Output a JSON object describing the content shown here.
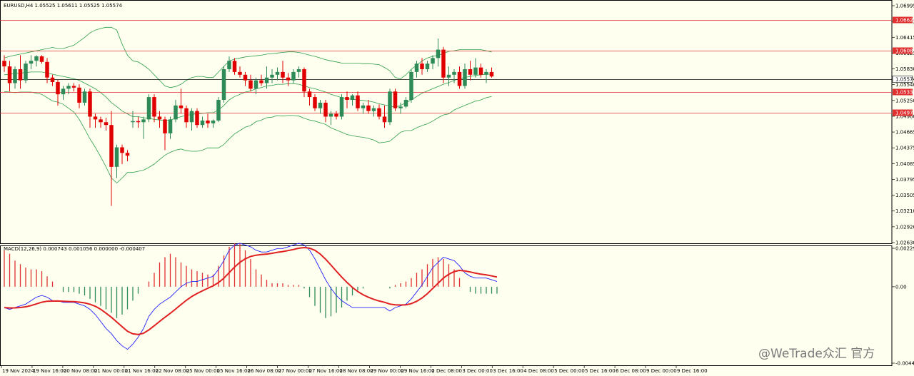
{
  "header": {
    "symbol": "EURUSD,H4",
    "ohlc": "1.05525 1.05611 1.05525 1.05574",
    "macd_label": "MACD(12,26,9) 0.000743 0.001056 0.000000 -0.000407"
  },
  "watermark": "@WeTrade众汇 官方",
  "colors": {
    "bull": "#2e8b57",
    "bear": "#e00000",
    "band": "#2e9e4a",
    "macd": "#2020ff",
    "signal": "#e02020",
    "level": "#e03030"
  },
  "chart_data": [
    {
      "type": "candlestick",
      "ylim": [
        1.0263,
        1.0699
      ],
      "price_ticks": [
        "1.06995",
        "1.06705",
        "1.06415",
        "1.06125",
        "1.05830",
        "1.05540",
        "1.05250",
        "1.04960",
        "1.04665",
        "1.04375",
        "1.04085",
        "1.03795",
        "1.03505",
        "1.03210",
        "1.02920",
        "1.02630"
      ],
      "level_labels": [
        "1.06628",
        "1.06085",
        "1.05574",
        "1.05338",
        "1.04971"
      ],
      "levels": [
        1.06628,
        1.06085,
        1.05338,
        1.04971
      ],
      "current_price": 1.05574,
      "x_labels": [
        "19 Nov 2024",
        "19 Nov 16:00",
        "20 Nov 08:00",
        "21 Nov 00:00",
        "21 Nov 16:00",
        "22 Nov 08:00",
        "25 Nov 00:00",
        "25 Nov 16:00",
        "26 Nov 08:00",
        "27 Nov 00:00",
        "27 Nov 16:00",
        "28 Nov 08:00",
        "29 Nov 00:00",
        "29 Nov 16:00",
        "2 Dec 08:00",
        "3 Dec 00:00",
        "3 Dec 16:00",
        "4 Dec 08:00",
        "5 Dec 00:00",
        "5 Dec 16:00",
        "6 Dec 08:00",
        "9 Dec 00:00",
        "9 Dec 16:00"
      ],
      "candles": [
        [
          1.059,
          1.06,
          1.057,
          1.058
        ],
        [
          1.058,
          1.059,
          1.0535,
          1.055
        ],
        [
          1.055,
          1.058,
          1.054,
          1.0575
        ],
        [
          1.0575,
          1.06,
          1.054,
          1.0555
        ],
        [
          1.0555,
          1.059,
          1.055,
          1.0585
        ],
        [
          1.0585,
          1.06,
          1.0575,
          1.059
        ],
        [
          1.059,
          1.06,
          1.058,
          1.0598
        ],
        [
          1.0598,
          1.06,
          1.0585,
          1.0588
        ],
        [
          1.0588,
          1.0595,
          1.055,
          1.056
        ],
        [
          1.056,
          1.0565,
          1.0545,
          1.0552
        ],
        [
          1.0552,
          1.0556,
          1.051,
          1.053
        ],
        [
          1.053,
          1.0545,
          1.052,
          1.054
        ],
        [
          1.054,
          1.055,
          1.053,
          1.0545
        ],
        [
          1.0545,
          1.055,
          1.0535,
          1.0542
        ],
        [
          1.0542,
          1.0548,
          1.0505,
          1.0515
        ],
        [
          1.0515,
          1.054,
          1.051,
          1.0535
        ],
        [
          1.0535,
          1.054,
          1.047,
          1.049
        ],
        [
          1.049,
          1.0495,
          1.047,
          1.0485
        ],
        [
          1.0485,
          1.049,
          1.047,
          1.048
        ],
        [
          1.048,
          1.0488,
          1.0465,
          1.0475
        ],
        [
          1.0475,
          1.05,
          1.033,
          1.04
        ],
        [
          1.04,
          1.044,
          1.038,
          1.0435
        ],
        [
          1.0435,
          1.044,
          1.0405,
          1.0425
        ],
        [
          1.0425,
          1.043,
          1.041,
          1.042
        ],
        [
          1.048,
          1.05,
          1.047,
          1.0482
        ],
        [
          1.0482,
          1.049,
          1.047,
          1.048
        ],
        [
          1.048,
          1.049,
          1.045,
          1.0485
        ],
        [
          1.0485,
          1.053,
          1.048,
          1.0525
        ],
        [
          1.0525,
          1.053,
          1.048,
          1.049
        ],
        [
          1.049,
          1.05,
          1.047,
          1.0485
        ],
        [
          1.0485,
          1.049,
          1.043,
          1.046
        ],
        [
          1.046,
          1.049,
          1.045,
          1.0485
        ],
        [
          1.0485,
          1.052,
          1.048,
          1.051
        ],
        [
          1.051,
          1.054,
          1.0495,
          1.0505
        ],
        [
          1.0505,
          1.051,
          1.047,
          1.048
        ],
        [
          1.048,
          1.0505,
          1.0465,
          1.05
        ],
        [
          1.05,
          1.0505,
          1.047,
          1.0475
        ],
        [
          1.0475,
          1.049,
          1.047,
          1.0483
        ],
        [
          1.0483,
          1.0495,
          1.047,
          1.0478
        ],
        [
          1.0478,
          1.0485,
          1.047,
          1.0483
        ],
        [
          1.0483,
          1.0525,
          1.048,
          1.052
        ],
        [
          1.052,
          1.058,
          1.0515,
          1.0575
        ],
        [
          1.0575,
          1.0598,
          1.057,
          1.059
        ],
        [
          1.059,
          1.0595,
          1.0565,
          1.057
        ],
        [
          1.057,
          1.058,
          1.056,
          1.0565
        ],
        [
          1.0565,
          1.057,
          1.0545,
          1.0555
        ],
        [
          1.0555,
          1.0565,
          1.0535,
          1.054
        ],
        [
          1.054,
          1.056,
          1.053,
          1.0555
        ],
        [
          1.0555,
          1.0565,
          1.0545,
          1.055
        ],
        [
          1.055,
          1.058,
          1.054,
          1.056
        ],
        [
          1.056,
          1.0575,
          1.055,
          1.0565
        ],
        [
          1.0565,
          1.0578,
          1.0555,
          1.057
        ],
        [
          1.057,
          1.059,
          1.055,
          1.056
        ],
        [
          1.056,
          1.0568,
          1.0545,
          1.0555
        ],
        [
          1.0555,
          1.0575,
          1.055,
          1.057
        ],
        [
          1.057,
          1.058,
          1.056,
          1.0575
        ],
        [
          1.0575,
          1.0578,
          1.0525,
          1.0535
        ],
        [
          1.0535,
          1.054,
          1.051,
          1.0525
        ],
        [
          1.0525,
          1.053,
          1.05,
          1.0505
        ],
        [
          1.0505,
          1.052,
          1.0495,
          1.0515
        ],
        [
          1.0515,
          1.052,
          1.048,
          1.049
        ],
        [
          1.049,
          1.05,
          1.0475,
          1.0495
        ],
        [
          1.0495,
          1.05,
          1.0485,
          1.049
        ],
        [
          1.049,
          1.053,
          1.0485,
          1.0525
        ],
        [
          1.0525,
          1.0535,
          1.0505,
          1.052
        ],
        [
          1.052,
          1.053,
          1.051,
          1.0528
        ],
        [
          1.0528,
          1.0535,
          1.05,
          1.0505
        ],
        [
          1.0505,
          1.0515,
          1.0495,
          1.051
        ],
        [
          1.051,
          1.052,
          1.0495,
          1.05
        ],
        [
          1.05,
          1.051,
          1.049,
          1.0505
        ],
        [
          1.0505,
          1.0512,
          1.0485,
          1.049
        ],
        [
          1.049,
          1.051,
          1.047,
          1.048
        ],
        [
          1.048,
          1.054,
          1.0475,
          1.0535
        ],
        [
          1.0535,
          1.054,
          1.05,
          1.0505
        ],
        [
          1.0505,
          1.0515,
          1.0495,
          1.0508
        ],
        [
          1.0508,
          1.0525,
          1.0505,
          1.052
        ],
        [
          1.052,
          1.0575,
          1.0515,
          1.057
        ],
        [
          1.057,
          1.059,
          1.056,
          1.0585
        ],
        [
          1.0585,
          1.0595,
          1.0565,
          1.0575
        ],
        [
          1.0575,
          1.059,
          1.057,
          1.0585
        ],
        [
          1.0585,
          1.06,
          1.0575,
          1.0595
        ],
        [
          1.0595,
          1.063,
          1.058,
          1.061
        ],
        [
          1.061,
          1.0615,
          1.055,
          1.056
        ],
        [
          1.056,
          1.058,
          1.0545,
          1.0565
        ],
        [
          1.0565,
          1.0575,
          1.055,
          1.057
        ],
        [
          1.057,
          1.058,
          1.054,
          1.0545
        ],
        [
          1.0545,
          1.0585,
          1.054,
          1.0575
        ],
        [
          1.0575,
          1.059,
          1.0555,
          1.0565
        ],
        [
          1.0565,
          1.0595,
          1.056,
          1.0578
        ],
        [
          1.0578,
          1.0585,
          1.056,
          1.0565
        ],
        [
          1.0565,
          1.0575,
          1.055,
          1.057
        ],
        [
          1.057,
          1.0578,
          1.056,
          1.0562
        ]
      ],
      "band_upper": [
        1.0595,
        1.0598,
        1.06,
        1.0602,
        1.0604,
        1.0606,
        1.0608,
        1.061,
        1.0612,
        1.0614,
        1.0612,
        1.0612,
        1.0615,
        1.0618,
        1.0625,
        1.0632,
        1.064,
        1.0645,
        1.0648,
        1.065,
        1.065,
        1.0645,
        1.062,
        1.06,
        1.059,
        1.0588,
        1.0582,
        1.0575,
        1.0565,
        1.0555,
        1.0545,
        1.0542,
        1.0544,
        1.0548,
        1.0555,
        1.056,
        1.0562,
        1.0562,
        1.056,
        1.056,
        1.057,
        1.058,
        1.059,
        1.0593,
        1.0595,
        1.0597,
        1.0598,
        1.0599,
        1.06,
        1.0602,
        1.0603,
        1.0604,
        1.0605,
        1.0606,
        1.0606,
        1.0605,
        1.0603,
        1.06,
        1.0598,
        1.0595,
        1.0592,
        1.059,
        1.0588,
        1.0586,
        1.0586,
        1.0586,
        1.0586,
        1.0585,
        1.0585,
        1.0584,
        1.0583,
        1.0578,
        1.0572,
        1.056,
        1.0558,
        1.0565,
        1.0575,
        1.0582,
        1.059,
        1.0595,
        1.0598,
        1.06,
        1.0603,
        1.0607,
        1.0608,
        1.061,
        1.061,
        1.061,
        1.061,
        1.061,
        1.0608,
        1.0606
      ],
      "band_middle": [
        1.0565,
        1.0566,
        1.0567,
        1.0568,
        1.0569,
        1.057,
        1.057,
        1.057,
        1.0568,
        1.0566,
        1.0564,
        1.0562,
        1.056,
        1.0558,
        1.0555,
        1.055,
        1.0545,
        1.054,
        1.0533,
        1.0525,
        1.0515,
        1.0508,
        1.05,
        1.0495,
        1.049,
        1.049,
        1.0488,
        1.0487,
        1.0485,
        1.0484,
        1.0483,
        1.0484,
        1.0487,
        1.049,
        1.0492,
        1.0494,
        1.0495,
        1.0496,
        1.0497,
        1.0497,
        1.0502,
        1.051,
        1.052,
        1.0526,
        1.053,
        1.0534,
        1.0536,
        1.054,
        1.0542,
        1.0545,
        1.0546,
        1.0548,
        1.0548,
        1.0549,
        1.0549,
        1.0548,
        1.0545,
        1.0542,
        1.054,
        1.0537,
        1.0534,
        1.053,
        1.0527,
        1.0524,
        1.0522,
        1.0521,
        1.052,
        1.0519,
        1.0518,
        1.0516,
        1.0513,
        1.0511,
        1.0509,
        1.0507,
        1.051,
        1.0515,
        1.052,
        1.0526,
        1.0532,
        1.0536,
        1.054,
        1.0544,
        1.0548,
        1.0551,
        1.0555,
        1.0558,
        1.056,
        1.0562,
        1.0564,
        1.0565,
        1.0566,
        1.0566
      ],
      "band_lower": [
        1.0535,
        1.0534,
        1.0533,
        1.0534,
        1.0534,
        1.0534,
        1.0532,
        1.053,
        1.0524,
        1.0518,
        1.0516,
        1.0512,
        1.0505,
        1.0498,
        1.0485,
        1.0468,
        1.045,
        1.0435,
        1.0418,
        1.04,
        1.038,
        1.0371,
        1.038,
        1.039,
        1.039,
        1.0392,
        1.0394,
        1.0399,
        1.0405,
        1.0413,
        1.0421,
        1.0426,
        1.043,
        1.0432,
        1.0429,
        1.0428,
        1.0428,
        1.043,
        1.0434,
        1.0434,
        1.0434,
        1.044,
        1.045,
        1.0459,
        1.0465,
        1.0471,
        1.0474,
        1.0481,
        1.0484,
        1.0488,
        1.0489,
        1.0492,
        1.0491,
        1.0492,
        1.0492,
        1.0491,
        1.0487,
        1.0484,
        1.0482,
        1.0479,
        1.0476,
        1.047,
        1.0466,
        1.0462,
        1.0458,
        1.0456,
        1.0454,
        1.0453,
        1.0451,
        1.0448,
        1.0443,
        1.0444,
        1.0446,
        1.0454,
        1.0462,
        1.0465,
        1.0465,
        1.047,
        1.0474,
        1.0477,
        1.0482,
        1.0488,
        1.0493,
        1.0495,
        1.0502,
        1.0506,
        1.051,
        1.0514,
        1.0518,
        1.052,
        1.0524,
        1.0526
      ]
    },
    {
      "type": "macd",
      "ylim": [
        -0.004437,
        0.002294
      ],
      "tick_labels": [
        "0.002294",
        "0.00",
        "-0.004437"
      ],
      "histogram": [
        0.0021,
        0.0019,
        0.0015,
        0.0013,
        0.0011,
        0.001,
        0.001,
        0.0009,
        0.0006,
        0.0003,
        0.0,
        -0.0003,
        -0.0003,
        -0.0003,
        -0.0004,
        -0.0005,
        -0.0007,
        -0.0009,
        -0.0011,
        -0.0013,
        -0.0015,
        -0.0018,
        -0.0016,
        -0.0013,
        -0.0008,
        -0.0004,
        0.0,
        0.0003,
        0.0008,
        0.0014,
        0.0017,
        0.0019,
        0.0017,
        0.0014,
        0.0012,
        0.001,
        0.0009,
        0.0008,
        0.0007,
        0.0007,
        0.0012,
        0.0018,
        0.0023,
        0.0025,
        0.0025,
        0.0021,
        0.0016,
        0.001,
        0.0007,
        0.0004,
        0.0002,
        0.0002,
        0.0002,
        0.0001,
        0.0001,
        0.0001,
        -0.0001,
        -0.0006,
        -0.0011,
        -0.0015,
        -0.0018,
        -0.0017,
        -0.0015,
        -0.0012,
        -0.0008,
        -0.0005,
        -0.0002,
        -0.0001,
        0.0,
        0.0,
        0.0,
        0.0,
        -0.0001,
        0.0001,
        0.0002,
        0.0003,
        0.0005,
        0.0008,
        0.001,
        0.0013,
        0.0016,
        0.0017,
        0.0016,
        0.0013,
        0.001,
        0.0005,
        0.0,
        -0.0003,
        -0.0004,
        -0.0004,
        -0.0004,
        -0.0004,
        -0.0004
      ],
      "macd": [
        -0.0012,
        -0.0013,
        -0.0012,
        -0.0011,
        -0.001,
        -0.0008,
        -0.0006,
        -0.0005,
        -0.0006,
        -0.0008,
        -0.0008,
        -0.0009,
        -0.0009,
        -0.0009,
        -0.001,
        -0.0011,
        -0.0013,
        -0.0016,
        -0.002,
        -0.0024,
        -0.0027,
        -0.0031,
        -0.0034,
        -0.0036,
        -0.0033,
        -0.0029,
        -0.0024,
        -0.0017,
        -0.0013,
        -0.001,
        -0.0008,
        -0.0006,
        -0.0003,
        0.0,
        0.0002,
        0.0003,
        0.0003,
        0.0004,
        0.0005,
        0.0006,
        0.001,
        0.0015,
        0.0021,
        0.0024,
        0.0025,
        0.0024,
        0.0023,
        0.0021,
        0.002,
        0.002,
        0.0021,
        0.0022,
        0.0022,
        0.0023,
        0.0024,
        0.0025,
        0.0024,
        0.0021,
        0.0016,
        0.001,
        0.0004,
        -0.0001,
        -0.0005,
        -0.0008,
        -0.001,
        -0.0012,
        -0.0012,
        -0.0012,
        -0.0012,
        -0.0012,
        -0.0012,
        -0.0012,
        -0.0014,
        -0.0012,
        -0.0011,
        -0.001,
        -0.0007,
        -0.0003,
        0.0001,
        0.0006,
        0.0011,
        0.0014,
        0.0017,
        0.0016,
        0.0015,
        0.0012,
        0.0008,
        0.0006,
        0.0005,
        0.0005,
        0.0005,
        0.0004,
        0.0003
      ]
    }
  ]
}
